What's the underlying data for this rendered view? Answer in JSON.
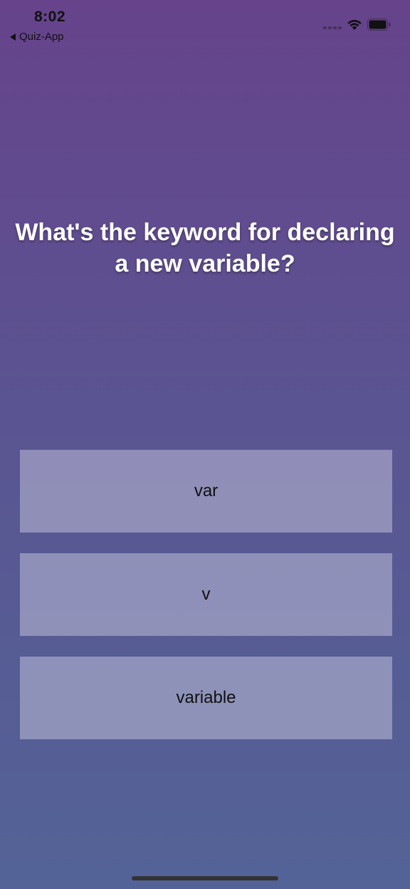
{
  "status_bar": {
    "time": "8:02",
    "back_label": "Quiz-App",
    "icons": [
      "signal-icon",
      "wifi-icon",
      "battery-icon"
    ]
  },
  "question": {
    "text": "What's the keyword for declaring a new variable?"
  },
  "answers": [
    {
      "label": "var"
    },
    {
      "label": "v"
    },
    {
      "label": "variable"
    }
  ],
  "colors": {
    "background_top": "#66438b",
    "background_bottom": "#536397",
    "question_text": "#ffffff"
  }
}
